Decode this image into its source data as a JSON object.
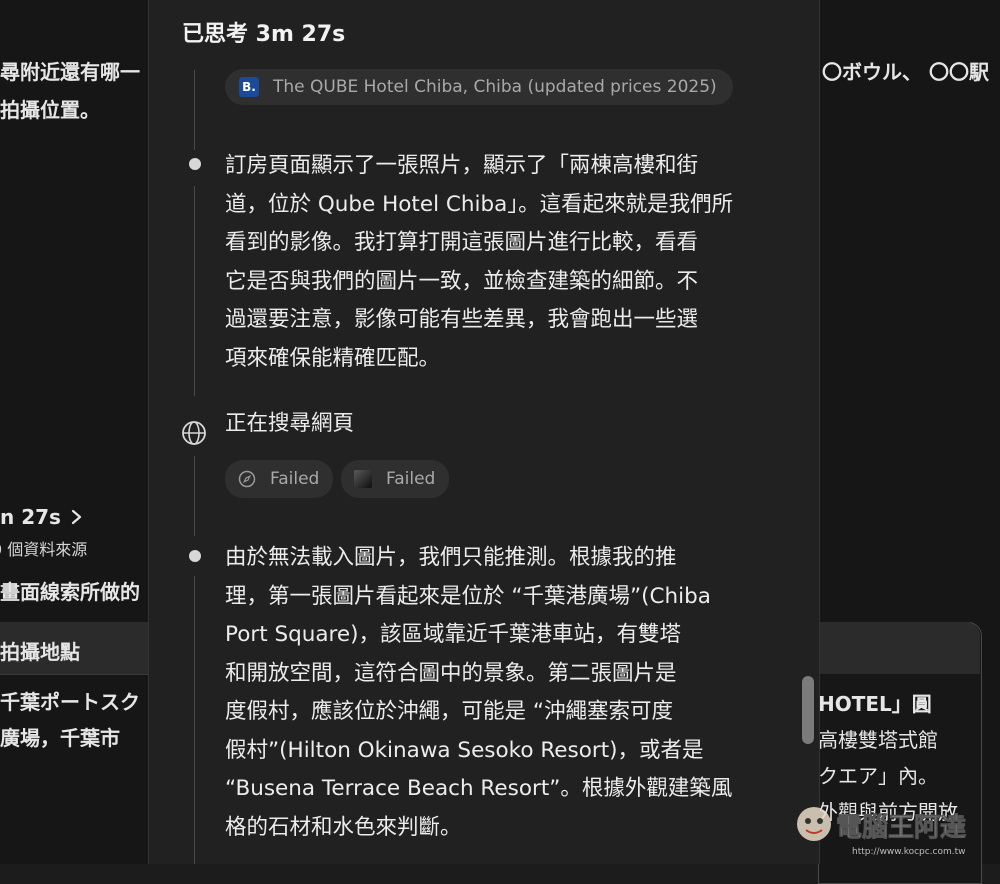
{
  "background_left": {
    "line1": "尋附近還有哪一",
    "line2": "拍攝位置。",
    "thinking_time": "n 27s",
    "chevron": "chevron-right",
    "sources": "0 個資料來源",
    "line3": "畫面線索所做的",
    "card_header": "拍攝地點",
    "card_line1": "千葉ポートスク",
    "card_line2": "廣場，千葉市"
  },
  "background_right": {
    "line1": "〇ボウル、 〇〇駅",
    "card_line1": "HOTEL」圓",
    "card_line2": "高樓雙塔式館",
    "card_line3": "クエア」內。",
    "card_line4": "外觀與前方開放"
  },
  "panel": {
    "title": "已思考 3m 27s",
    "source_chip": {
      "badge": "B.",
      "label": "The QUBE Hotel Chiba, Chiba (updated prices 2025)"
    },
    "paragraph1": [
      "訂房頁面顯示了一張照片，顯示了「兩棟高樓和街",
      "道，位於 Qube Hotel Chiba」。這看起來就是我們所",
      "看到的影像。我打算打開這張圖片進行比較，看看",
      "它是否與我們的圖片一致，並檢查建築的細節。不",
      "過還要注意，影像可能有些差異，我會跑出一些選",
      "項來確保能精確匹配。"
    ],
    "search_label": "正在搜尋網頁",
    "failed_chips": [
      {
        "icon": "compass-icon",
        "label": "Failed"
      },
      {
        "icon": "favicon-icon",
        "label": "Failed"
      }
    ],
    "paragraph2": [
      "由於無法載入圖片，我們只能推測。根據我的推",
      "理，第一張圖片看起來是位於 “千葉港廣場”(Chiba",
      "Port Square)，該區域靠近千葉港車站，有雙塔",
      "和開放空間，這符合圖中的景象。第二張圖片是",
      "度假村，應該位於沖繩，可能是 “沖繩塞索可度",
      "假村”(Hilton Okinawa Sesoko Resort)，或者是",
      "“Busena Terrace Beach Resort”。根據外觀建築風",
      "格的石材和水色來判斷。"
    ]
  },
  "watermark": {
    "text": "電腦王阿達",
    "url": "http://www.kocpc.com.tw"
  },
  "colors": {
    "page_bg": "#161616",
    "panel_bg": "#212121",
    "chip_bg": "#2f2f2f",
    "badge_blue": "#1a4a9a"
  }
}
